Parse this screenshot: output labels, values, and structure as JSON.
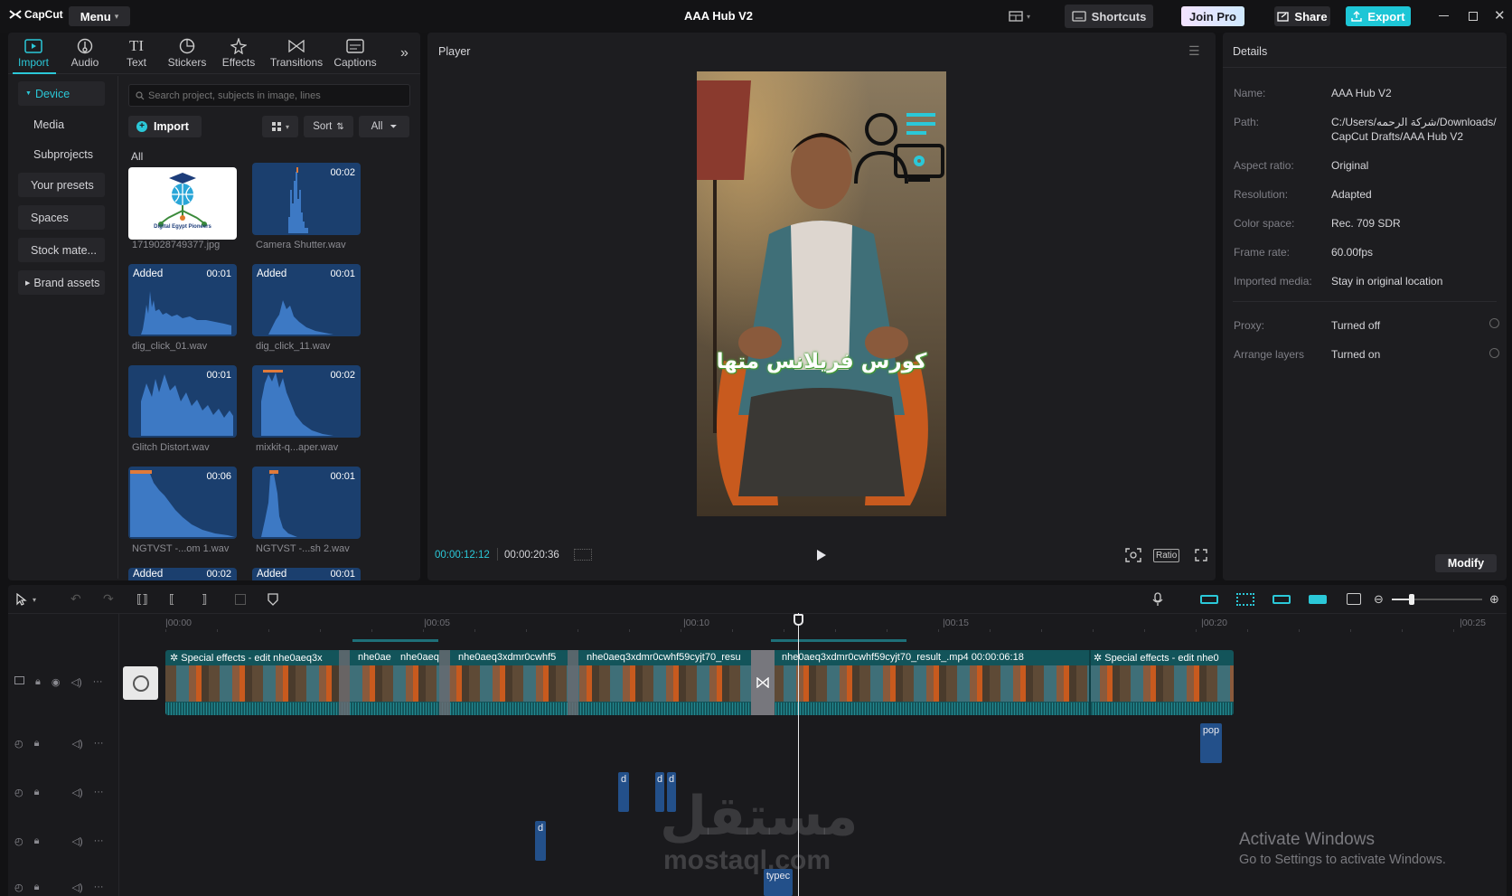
{
  "app": {
    "logo_text": "CapCut",
    "menu_label": "Menu",
    "window_title": "AAA Hub V2",
    "shortcuts_label": "Shortcuts",
    "join_pro_label": "Join Pro",
    "share_label": "Share",
    "export_label": "Export"
  },
  "media_tabs": [
    {
      "label": "Import",
      "icon": "import-icon",
      "active": true
    },
    {
      "label": "Audio",
      "icon": "audio-icon"
    },
    {
      "label": "Text",
      "icon": "text-icon"
    },
    {
      "label": "Stickers",
      "icon": "stickers-icon"
    },
    {
      "label": "Effects",
      "icon": "effects-icon"
    },
    {
      "label": "Transitions",
      "icon": "transitions-icon"
    },
    {
      "label": "Captions",
      "icon": "captions-icon"
    }
  ],
  "sidebar": {
    "items": [
      {
        "label": "Device",
        "active": true
      },
      {
        "label": "Media"
      },
      {
        "label": "Subprojects"
      },
      {
        "label": "Your presets"
      },
      {
        "label": "Spaces"
      },
      {
        "label": "Stock mate..."
      },
      {
        "label": "Brand assets"
      }
    ]
  },
  "library": {
    "search_placeholder": "Search project, subjects in image, lines",
    "import_label": "Import",
    "sort_label": "Sort",
    "filter_label": "All",
    "section_label": "All",
    "added_text": "Added",
    "logo_caption": "Digital Egypt Pioneers",
    "items": [
      {
        "name": "1719028749377.jpg",
        "duration": "",
        "added": false,
        "kind": "image"
      },
      {
        "name": "Camera Shutter.wav",
        "duration": "00:02",
        "added": false,
        "kind": "audio"
      },
      {
        "name": "dig_click_01.wav",
        "duration": "00:01",
        "added": true,
        "kind": "audio"
      },
      {
        "name": "dig_click_11.wav",
        "duration": "00:01",
        "added": true,
        "kind": "audio"
      },
      {
        "name": "Glitch Distort.wav",
        "duration": "00:01",
        "added": false,
        "kind": "audio"
      },
      {
        "name": "mixkit-q...aper.wav",
        "duration": "00:02",
        "added": false,
        "kind": "audio"
      },
      {
        "name": "NGTVST -...om 1.wav",
        "duration": "00:06",
        "added": false,
        "kind": "audio"
      },
      {
        "name": "NGTVST -...sh 2.wav",
        "duration": "00:01",
        "added": false,
        "kind": "audio"
      },
      {
        "name": "",
        "duration": "00:02",
        "added": true,
        "kind": "audio"
      },
      {
        "name": "",
        "duration": "00:01",
        "added": true,
        "kind": "audio"
      }
    ]
  },
  "player": {
    "title": "Player",
    "current_time": "00:00:12:12",
    "total_time": "00:00:20:36",
    "ratio_label": "Ratio",
    "caption_text": "كورس فريلانس متها"
  },
  "details": {
    "title": "Details",
    "rows": [
      {
        "key": "Name:",
        "value": "AAA Hub V2"
      },
      {
        "key": "Path:",
        "value": "C:/Users/شركة الرحمه/Downloads/ CapCut Drafts/AAA Hub V2"
      },
      {
        "key": "Aspect ratio:",
        "value": "Original"
      },
      {
        "key": "Resolution:",
        "value": "Adapted"
      },
      {
        "key": "Color space:",
        "value": "Rec. 709 SDR"
      },
      {
        "key": "Frame rate:",
        "value": "60.00fps"
      },
      {
        "key": "Imported media:",
        "value": "Stay in original location"
      },
      {
        "key": "Proxy:",
        "value": "Turned off"
      },
      {
        "key": "Arrange layers",
        "value": "Turned on"
      }
    ],
    "modify_label": "Modify"
  },
  "timeline": {
    "ruler": [
      "|00:00",
      "|00:05",
      "|00:10",
      "|00:15",
      "|00:20",
      "|00:25"
    ],
    "clips": [
      {
        "label": "Special effects - edit  nhe0aeq3x"
      },
      {
        "label": "nhe0ae"
      },
      {
        "label": "nhe0aeq"
      },
      {
        "label": "nhe0aeq3xdmr0cwhf5"
      },
      {
        "label": "nhe0aeq3xdmr0cwhf59cyjt70_resu"
      },
      {
        "label": "nhe0aeq3xdmr0cwhf59cyjt70_result_.mp4   00:00:06:18"
      },
      {
        "label": "Special effects - edit  nhe0"
      }
    ],
    "audio_clips": [
      {
        "label": "pop"
      },
      {
        "label": "d"
      },
      {
        "label": "d"
      },
      {
        "label": "d"
      },
      {
        "label": "d"
      },
      {
        "label": "typec"
      }
    ]
  },
  "watermark": {
    "logo_text": "مستقل",
    "site": "mostaql.com"
  },
  "activation": {
    "title": "Activate Windows",
    "subtitle": "Go to Settings to activate Windows."
  }
}
